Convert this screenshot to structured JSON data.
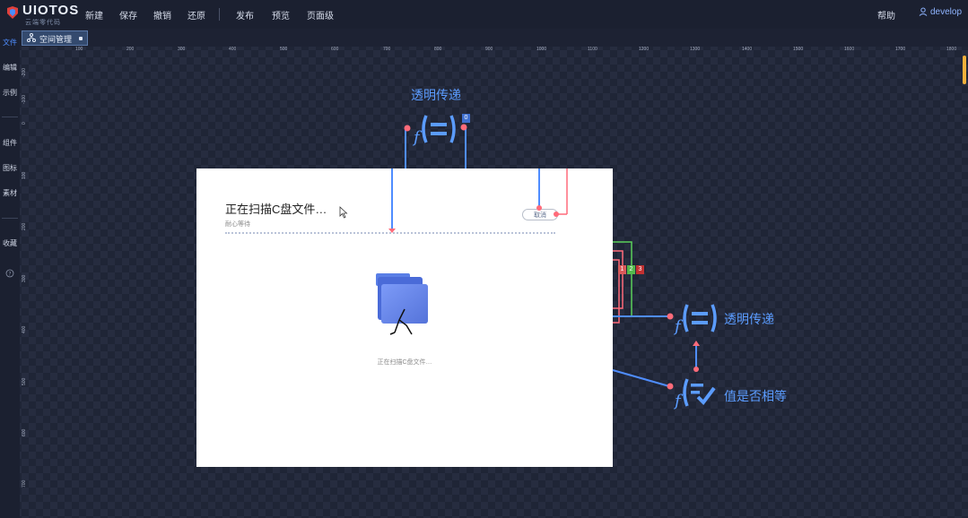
{
  "app": {
    "logo_text": "UIOTOS",
    "logo_sub": "云端零代码"
  },
  "menu": [
    "新建",
    "保存",
    "撤销",
    "还原",
    "发布",
    "预览",
    "页面级"
  ],
  "topbar": {
    "help": "帮助",
    "user": "develop"
  },
  "tab": {
    "label": "空间管理"
  },
  "sidebar": [
    {
      "label": "文件",
      "active": true
    },
    {
      "label": "编辑"
    },
    {
      "label": "示例"
    },
    {
      "label": "组件"
    },
    {
      "label": "图标"
    },
    {
      "label": "素材"
    },
    {
      "label": "收藏"
    }
  ],
  "ruler_h": [
    "100",
    "200",
    "300",
    "400",
    "500",
    "600",
    "700",
    "800",
    "900",
    "1000",
    "1100",
    "1200",
    "1300",
    "1400",
    "1500",
    "1600",
    "1700",
    "1800"
  ],
  "ruler_v": [
    "-200",
    "-100",
    "0",
    "100",
    "200",
    "300",
    "400",
    "500",
    "600",
    "700"
  ],
  "canvas": {
    "title": "正在扫描C盘文件…",
    "subtitle": "耐心等待",
    "cancel": "取消",
    "status": "正在扫描C盘文件…"
  },
  "nodes": {
    "top_label": "透明传递",
    "top_badge": "0",
    "right_label": "透明传递",
    "bottom_label": "值是否相等",
    "badges": [
      "1",
      "2",
      "3"
    ]
  },
  "colors": {
    "accent": "#5b9cff",
    "wire_blue": "#4f8dff",
    "wire_red": "#ff6b7a",
    "wire_green": "#5ad05a"
  },
  "icons": [
    "apps-icon",
    "user-icon",
    "function-equal-icon",
    "function-compare-icon",
    "folder-icon",
    "cursor-icon"
  ]
}
